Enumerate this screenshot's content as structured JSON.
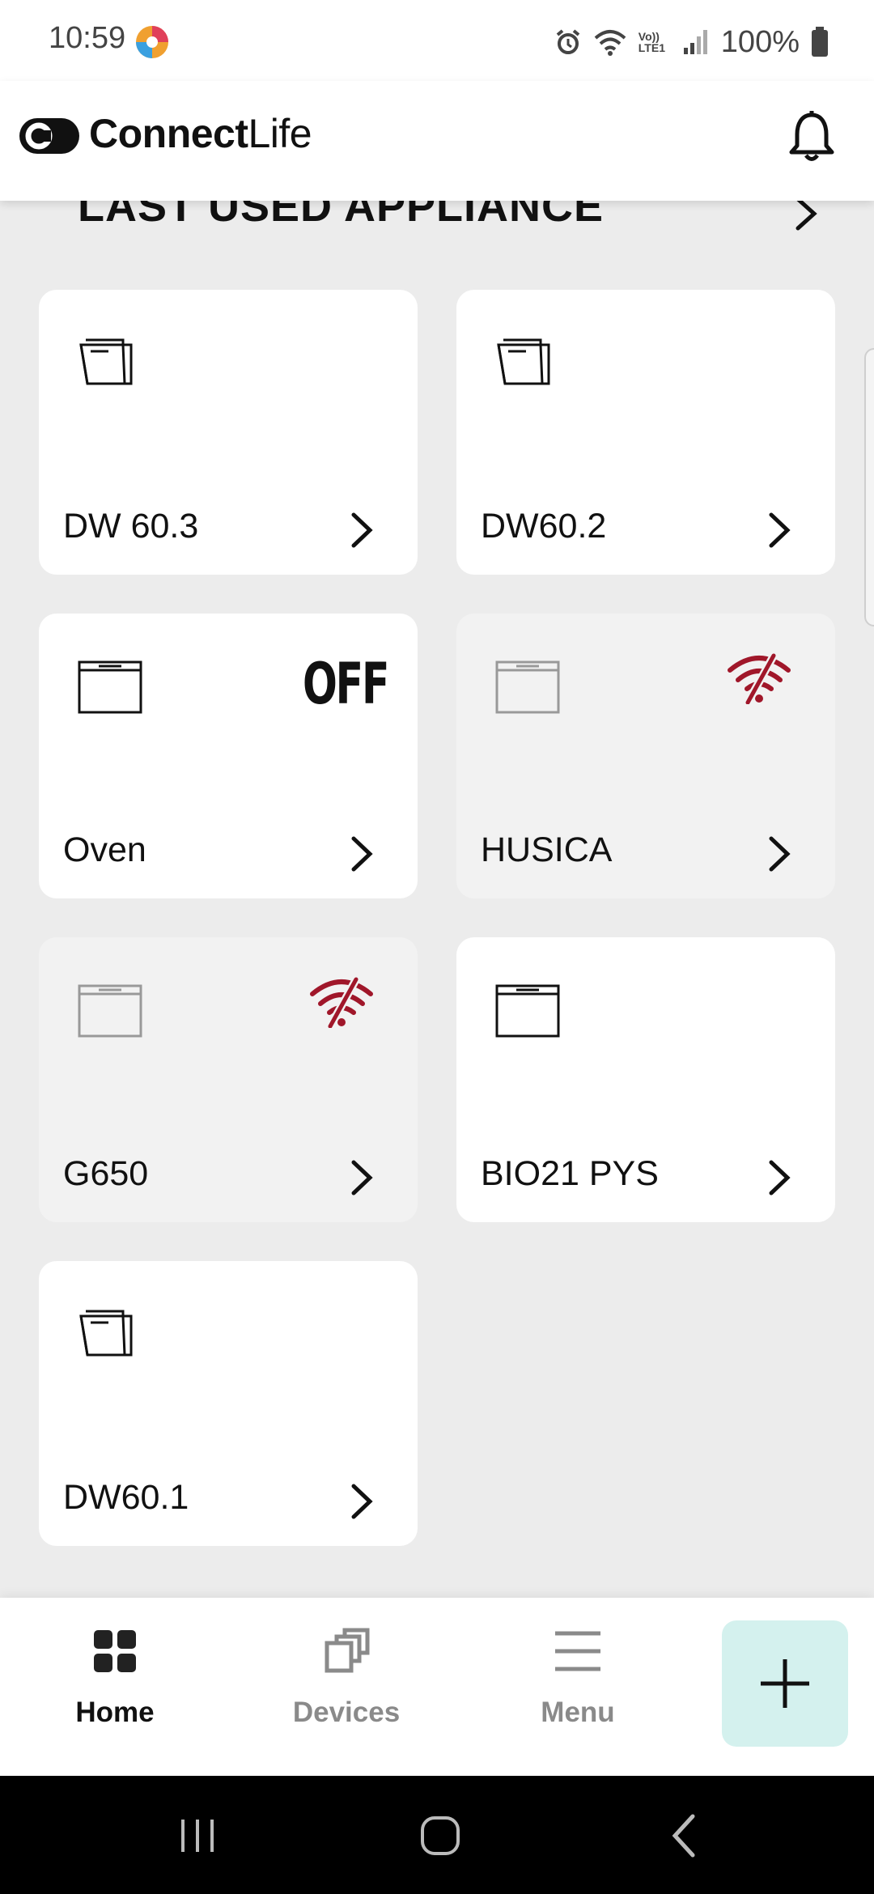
{
  "status_bar": {
    "time": "10:59",
    "network_label": "Vo)) LTE1",
    "battery": "100%"
  },
  "header": {
    "brand_bold": "Connect",
    "brand_light": "Life",
    "notification_icon": "bell-icon"
  },
  "section": {
    "title": "LAST USED APPLIANCE"
  },
  "appliances": [
    {
      "name": "DW 60.3",
      "icon": "dishwasher-icon",
      "status": ""
    },
    {
      "name": "DW60.2",
      "icon": "dishwasher-icon",
      "status": ""
    },
    {
      "name": "Oven",
      "icon": "oven-icon",
      "status": "OFF"
    },
    {
      "name": "HUSICA",
      "icon": "oven-icon",
      "status": "offline"
    },
    {
      "name": "G650",
      "icon": "oven-icon",
      "status": "offline"
    },
    {
      "name": "BIO21 PYS",
      "icon": "oven-icon",
      "status": ""
    },
    {
      "name": "DW60.1",
      "icon": "dishwasher-icon",
      "status": ""
    }
  ],
  "bottom_nav": {
    "home": "Home",
    "devices": "Devices",
    "menu": "Menu",
    "add_icon": "plus-icon"
  },
  "colors": {
    "offline_wifi": "#a0172a",
    "add_button_bg": "#d4f1ee",
    "page_bg": "#ececec"
  }
}
